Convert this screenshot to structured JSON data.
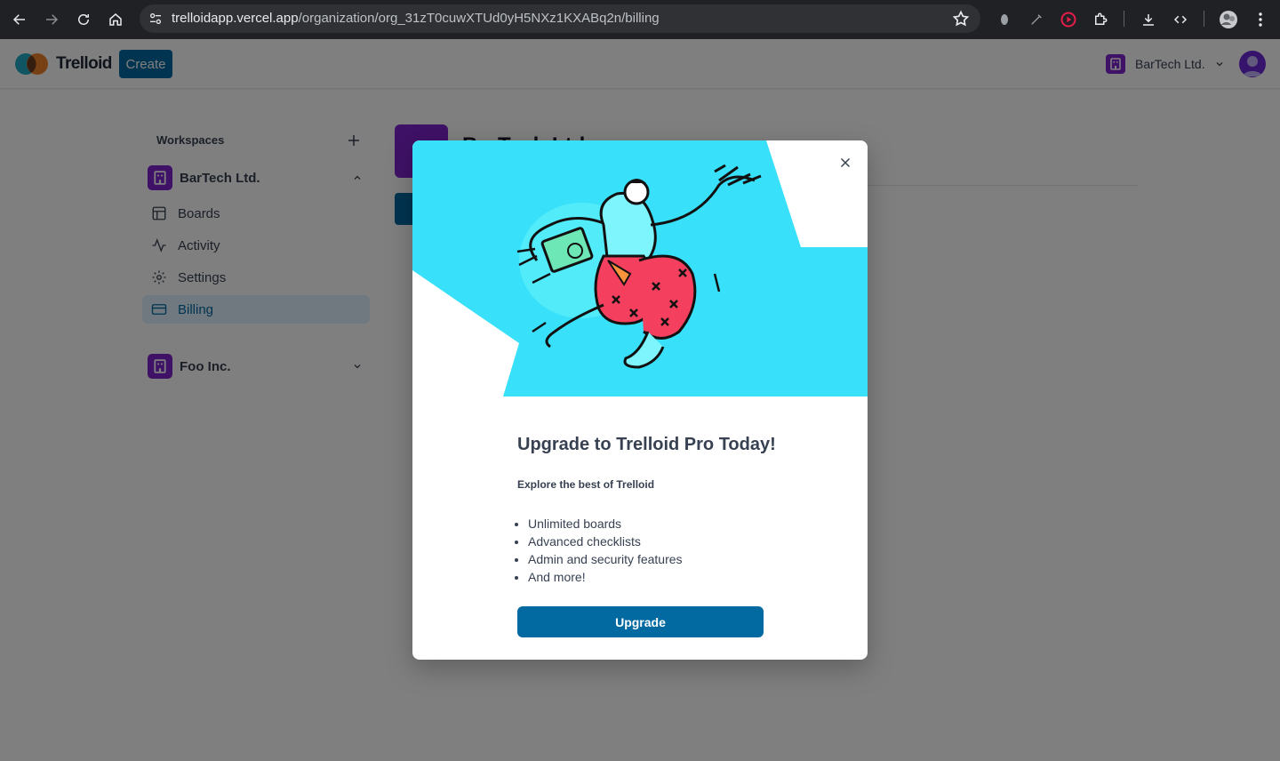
{
  "browser": {
    "url_host": "trelloidapp.vercel.app",
    "url_path": "/organization/org_31zT0cuwXTUd0yH5NXz1KXABq2n/billing"
  },
  "header": {
    "logo_text": "Trelloid",
    "create_label": "Create",
    "org_name": "BarTech Ltd."
  },
  "sidebar": {
    "title": "Workspaces",
    "orgs": [
      {
        "name": "BarTech Ltd.",
        "expanded": true,
        "items": [
          {
            "label": "Boards",
            "icon": "layout-icon"
          },
          {
            "label": "Activity",
            "icon": "activity-icon"
          },
          {
            "label": "Settings",
            "icon": "settings-icon"
          },
          {
            "label": "Billing",
            "icon": "credit-card-icon",
            "active": true
          }
        ]
      },
      {
        "name": "Foo Inc.",
        "expanded": false
      }
    ]
  },
  "main": {
    "org_title": "BarTech Ltd."
  },
  "modal": {
    "title": "Upgrade to Trelloid Pro Today!",
    "subtitle": "Explore the best of Trelloid",
    "features": [
      "Unlimited boards",
      "Advanced checklists",
      "Admin and security features",
      "And more!"
    ],
    "cta_label": "Upgrade"
  },
  "colors": {
    "primary": "#0369a1",
    "org_badge": "#7e22ce",
    "hero_bg": "#38e1f9",
    "active_nav_bg": "#e0f2fe"
  }
}
